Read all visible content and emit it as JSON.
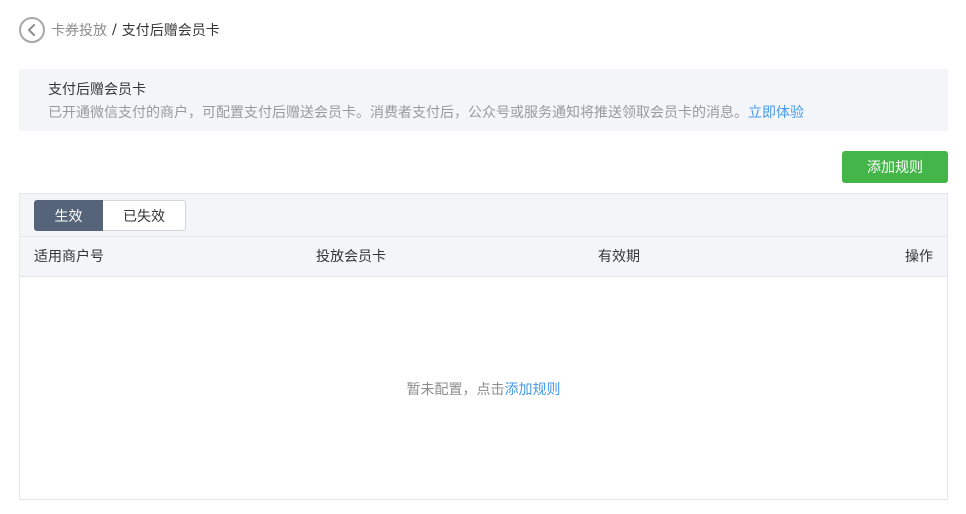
{
  "breadcrumb": {
    "parent": "卡券投放",
    "separator": "/",
    "current": "支付后赠会员卡"
  },
  "banner": {
    "title": "支付后赠会员卡",
    "description": "已开通微信支付的商户，可配置支付后赠送会员卡。消费者支付后，公众号或服务通知将推送领取会员卡的消息。",
    "link": "立即体验"
  },
  "toolbar": {
    "add_rule_label": "添加规则"
  },
  "tabs": [
    {
      "label": "生效",
      "active": true
    },
    {
      "label": "已失效",
      "active": false
    }
  ],
  "table": {
    "columns": [
      "适用商户号",
      "投放会员卡",
      "有效期",
      "操作"
    ],
    "rows": []
  },
  "empty_state": {
    "text": "暂未配置，点击",
    "link": "添加规则"
  },
  "colors": {
    "primary_green": "#44b549",
    "tab_active": "#566479",
    "link_blue": "#459ae9",
    "banner_bg": "#f4f5f9"
  }
}
